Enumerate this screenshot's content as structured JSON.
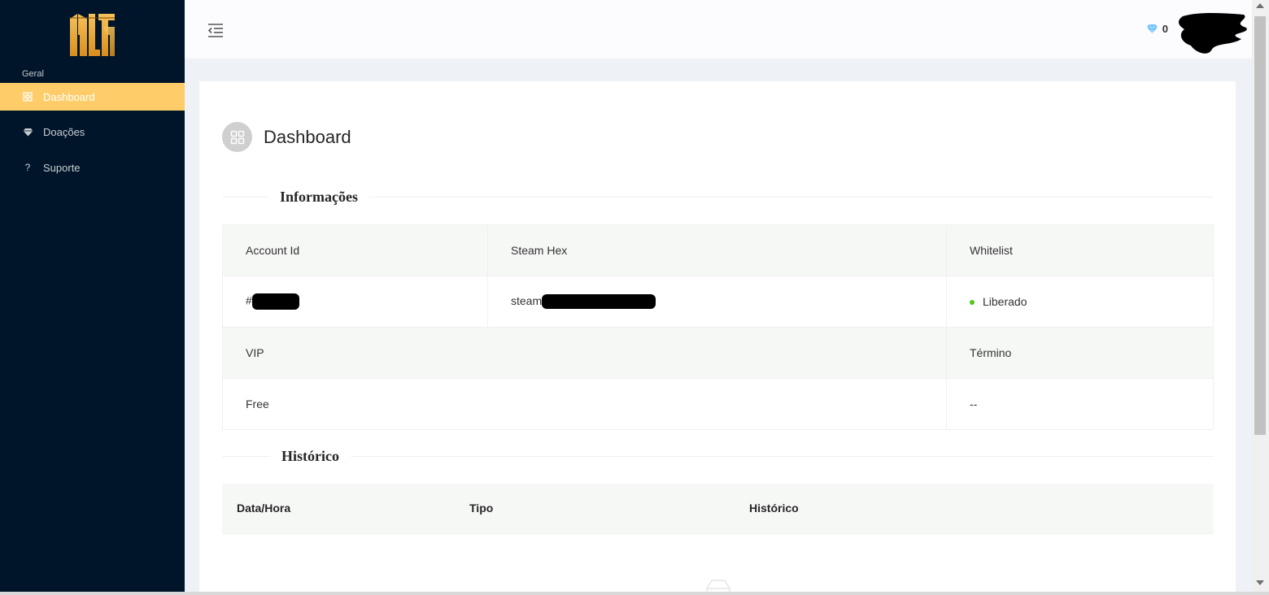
{
  "sidebar": {
    "logo_text": "ALTA",
    "group_label": "Geral",
    "items": [
      {
        "label": "Dashboard",
        "icon": "grid-icon",
        "active": true
      },
      {
        "label": "Doações",
        "icon": "diamond-icon",
        "active": false
      },
      {
        "label": "Suporte",
        "icon": "question-icon",
        "active": false
      }
    ]
  },
  "header": {
    "gem_count": "0"
  },
  "main": {
    "page_title": "Dashboard",
    "info_section": {
      "title": "Informações",
      "headers": [
        "Account Id",
        "Steam Hex",
        "Whitelist"
      ],
      "values": {
        "account_id": "#",
        "steam_hex": "steam",
        "whitelist": "Liberado"
      },
      "vip_label": "VIP",
      "termino_label": "Término",
      "vip_value": "Free",
      "termino_value": "--"
    },
    "history_section": {
      "title": "Histórico",
      "columns": [
        "Data/Hora",
        "Tipo",
        "Histórico"
      ]
    }
  },
  "colors": {
    "sidebar_bg": "#001529",
    "active_item": "#fecd69",
    "status_ok": "#52c41a",
    "gem": "#69c0ff"
  }
}
